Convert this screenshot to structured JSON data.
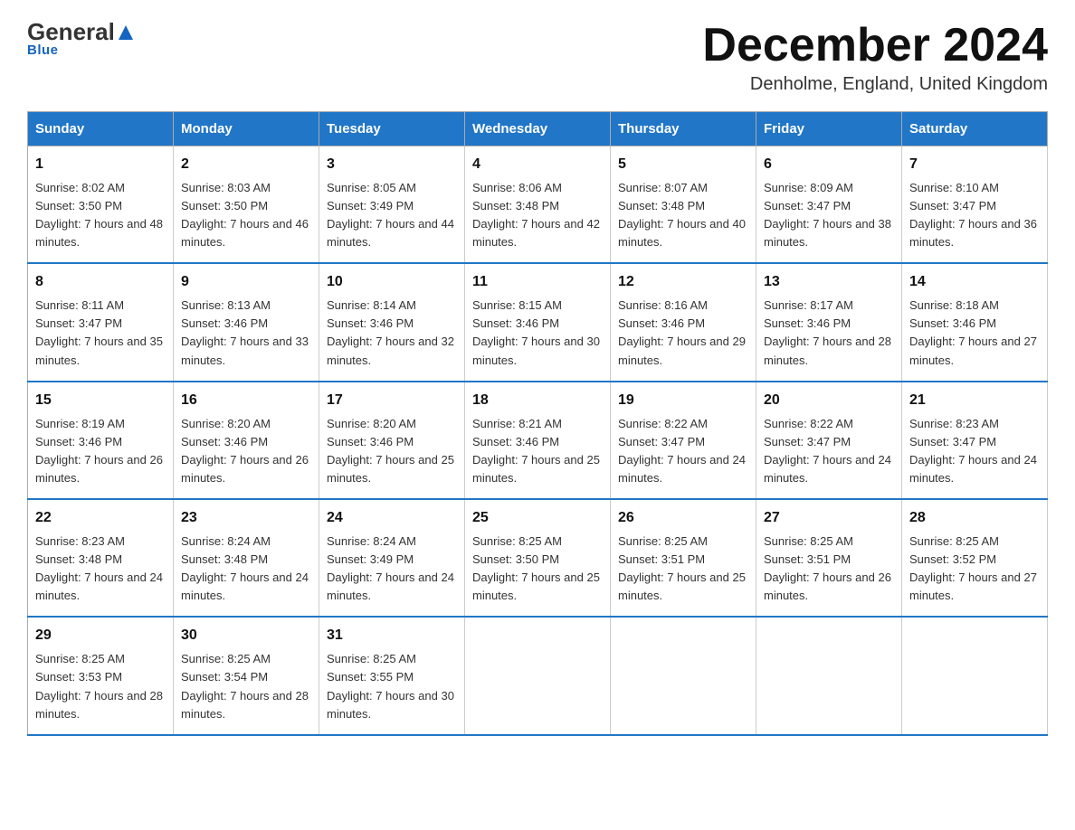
{
  "header": {
    "logo_general": "General",
    "logo_blue": "Blue",
    "month_title": "December 2024",
    "location": "Denholme, England, United Kingdom"
  },
  "weekdays": [
    "Sunday",
    "Monday",
    "Tuesday",
    "Wednesday",
    "Thursday",
    "Friday",
    "Saturday"
  ],
  "weeks": [
    [
      {
        "day": "1",
        "sunrise": "Sunrise: 8:02 AM",
        "sunset": "Sunset: 3:50 PM",
        "daylight": "Daylight: 7 hours and 48 minutes."
      },
      {
        "day": "2",
        "sunrise": "Sunrise: 8:03 AM",
        "sunset": "Sunset: 3:50 PM",
        "daylight": "Daylight: 7 hours and 46 minutes."
      },
      {
        "day": "3",
        "sunrise": "Sunrise: 8:05 AM",
        "sunset": "Sunset: 3:49 PM",
        "daylight": "Daylight: 7 hours and 44 minutes."
      },
      {
        "day": "4",
        "sunrise": "Sunrise: 8:06 AM",
        "sunset": "Sunset: 3:48 PM",
        "daylight": "Daylight: 7 hours and 42 minutes."
      },
      {
        "day": "5",
        "sunrise": "Sunrise: 8:07 AM",
        "sunset": "Sunset: 3:48 PM",
        "daylight": "Daylight: 7 hours and 40 minutes."
      },
      {
        "day": "6",
        "sunrise": "Sunrise: 8:09 AM",
        "sunset": "Sunset: 3:47 PM",
        "daylight": "Daylight: 7 hours and 38 minutes."
      },
      {
        "day": "7",
        "sunrise": "Sunrise: 8:10 AM",
        "sunset": "Sunset: 3:47 PM",
        "daylight": "Daylight: 7 hours and 36 minutes."
      }
    ],
    [
      {
        "day": "8",
        "sunrise": "Sunrise: 8:11 AM",
        "sunset": "Sunset: 3:47 PM",
        "daylight": "Daylight: 7 hours and 35 minutes."
      },
      {
        "day": "9",
        "sunrise": "Sunrise: 8:13 AM",
        "sunset": "Sunset: 3:46 PM",
        "daylight": "Daylight: 7 hours and 33 minutes."
      },
      {
        "day": "10",
        "sunrise": "Sunrise: 8:14 AM",
        "sunset": "Sunset: 3:46 PM",
        "daylight": "Daylight: 7 hours and 32 minutes."
      },
      {
        "day": "11",
        "sunrise": "Sunrise: 8:15 AM",
        "sunset": "Sunset: 3:46 PM",
        "daylight": "Daylight: 7 hours and 30 minutes."
      },
      {
        "day": "12",
        "sunrise": "Sunrise: 8:16 AM",
        "sunset": "Sunset: 3:46 PM",
        "daylight": "Daylight: 7 hours and 29 minutes."
      },
      {
        "day": "13",
        "sunrise": "Sunrise: 8:17 AM",
        "sunset": "Sunset: 3:46 PM",
        "daylight": "Daylight: 7 hours and 28 minutes."
      },
      {
        "day": "14",
        "sunrise": "Sunrise: 8:18 AM",
        "sunset": "Sunset: 3:46 PM",
        "daylight": "Daylight: 7 hours and 27 minutes."
      }
    ],
    [
      {
        "day": "15",
        "sunrise": "Sunrise: 8:19 AM",
        "sunset": "Sunset: 3:46 PM",
        "daylight": "Daylight: 7 hours and 26 minutes."
      },
      {
        "day": "16",
        "sunrise": "Sunrise: 8:20 AM",
        "sunset": "Sunset: 3:46 PM",
        "daylight": "Daylight: 7 hours and 26 minutes."
      },
      {
        "day": "17",
        "sunrise": "Sunrise: 8:20 AM",
        "sunset": "Sunset: 3:46 PM",
        "daylight": "Daylight: 7 hours and 25 minutes."
      },
      {
        "day": "18",
        "sunrise": "Sunrise: 8:21 AM",
        "sunset": "Sunset: 3:46 PM",
        "daylight": "Daylight: 7 hours and 25 minutes."
      },
      {
        "day": "19",
        "sunrise": "Sunrise: 8:22 AM",
        "sunset": "Sunset: 3:47 PM",
        "daylight": "Daylight: 7 hours and 24 minutes."
      },
      {
        "day": "20",
        "sunrise": "Sunrise: 8:22 AM",
        "sunset": "Sunset: 3:47 PM",
        "daylight": "Daylight: 7 hours and 24 minutes."
      },
      {
        "day": "21",
        "sunrise": "Sunrise: 8:23 AM",
        "sunset": "Sunset: 3:47 PM",
        "daylight": "Daylight: 7 hours and 24 minutes."
      }
    ],
    [
      {
        "day": "22",
        "sunrise": "Sunrise: 8:23 AM",
        "sunset": "Sunset: 3:48 PM",
        "daylight": "Daylight: 7 hours and 24 minutes."
      },
      {
        "day": "23",
        "sunrise": "Sunrise: 8:24 AM",
        "sunset": "Sunset: 3:48 PM",
        "daylight": "Daylight: 7 hours and 24 minutes."
      },
      {
        "day": "24",
        "sunrise": "Sunrise: 8:24 AM",
        "sunset": "Sunset: 3:49 PM",
        "daylight": "Daylight: 7 hours and 24 minutes."
      },
      {
        "day": "25",
        "sunrise": "Sunrise: 8:25 AM",
        "sunset": "Sunset: 3:50 PM",
        "daylight": "Daylight: 7 hours and 25 minutes."
      },
      {
        "day": "26",
        "sunrise": "Sunrise: 8:25 AM",
        "sunset": "Sunset: 3:51 PM",
        "daylight": "Daylight: 7 hours and 25 minutes."
      },
      {
        "day": "27",
        "sunrise": "Sunrise: 8:25 AM",
        "sunset": "Sunset: 3:51 PM",
        "daylight": "Daylight: 7 hours and 26 minutes."
      },
      {
        "day": "28",
        "sunrise": "Sunrise: 8:25 AM",
        "sunset": "Sunset: 3:52 PM",
        "daylight": "Daylight: 7 hours and 27 minutes."
      }
    ],
    [
      {
        "day": "29",
        "sunrise": "Sunrise: 8:25 AM",
        "sunset": "Sunset: 3:53 PM",
        "daylight": "Daylight: 7 hours and 28 minutes."
      },
      {
        "day": "30",
        "sunrise": "Sunrise: 8:25 AM",
        "sunset": "Sunset: 3:54 PM",
        "daylight": "Daylight: 7 hours and 28 minutes."
      },
      {
        "day": "31",
        "sunrise": "Sunrise: 8:25 AM",
        "sunset": "Sunset: 3:55 PM",
        "daylight": "Daylight: 7 hours and 30 minutes."
      },
      null,
      null,
      null,
      null
    ]
  ]
}
